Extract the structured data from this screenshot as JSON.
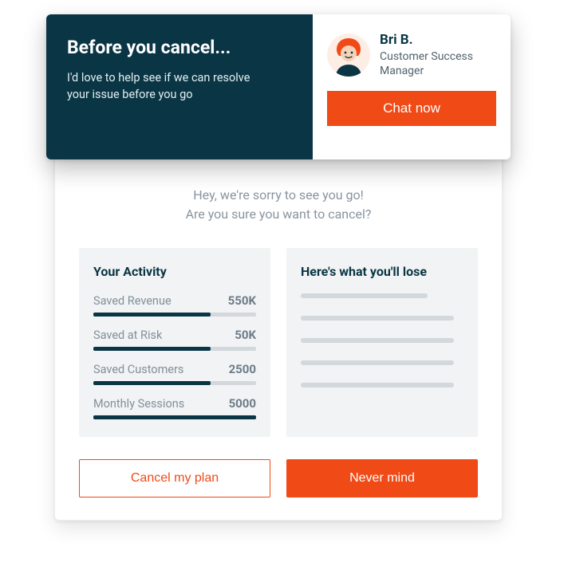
{
  "banner": {
    "title": "Before you cancel...",
    "subtitle": "I'd love to help see if we can resolve your issue before you go",
    "agent": {
      "name": "Bri B.",
      "role": "Customer Success Manager"
    },
    "chat_button": "Chat now"
  },
  "modal": {
    "heading_line1": "Hey, we're sorry to see you go!",
    "heading_line2": "Are you sure you want to cancel?",
    "activity": {
      "title": "Your Activity",
      "metrics": [
        {
          "label": "Saved Revenue",
          "value": "550K",
          "fill": 72
        },
        {
          "label": "Saved at Risk",
          "value": "50K",
          "fill": 72
        },
        {
          "label": "Saved Customers",
          "value": "2500",
          "fill": 72
        },
        {
          "label": "Monthly Sessions",
          "value": "5000",
          "fill": 100
        }
      ]
    },
    "lose": {
      "title": "Here's what you'll lose"
    },
    "cancel_button": "Cancel my plan",
    "nevermind_button": "Never mind"
  },
  "colors": {
    "accent": "#f04a17",
    "dark": "#0a3544"
  },
  "chart_data": {
    "type": "bar",
    "categories": [
      "Saved Revenue",
      "Saved at Risk",
      "Saved Customers",
      "Monthly Sessions"
    ],
    "values_raw": [
      "550K",
      "50K",
      "2500",
      "5000"
    ],
    "fill_pct": [
      72,
      72,
      72,
      100
    ],
    "title": "Your Activity",
    "xlabel": "",
    "ylabel": "",
    "ylim": [
      0,
      100
    ]
  }
}
